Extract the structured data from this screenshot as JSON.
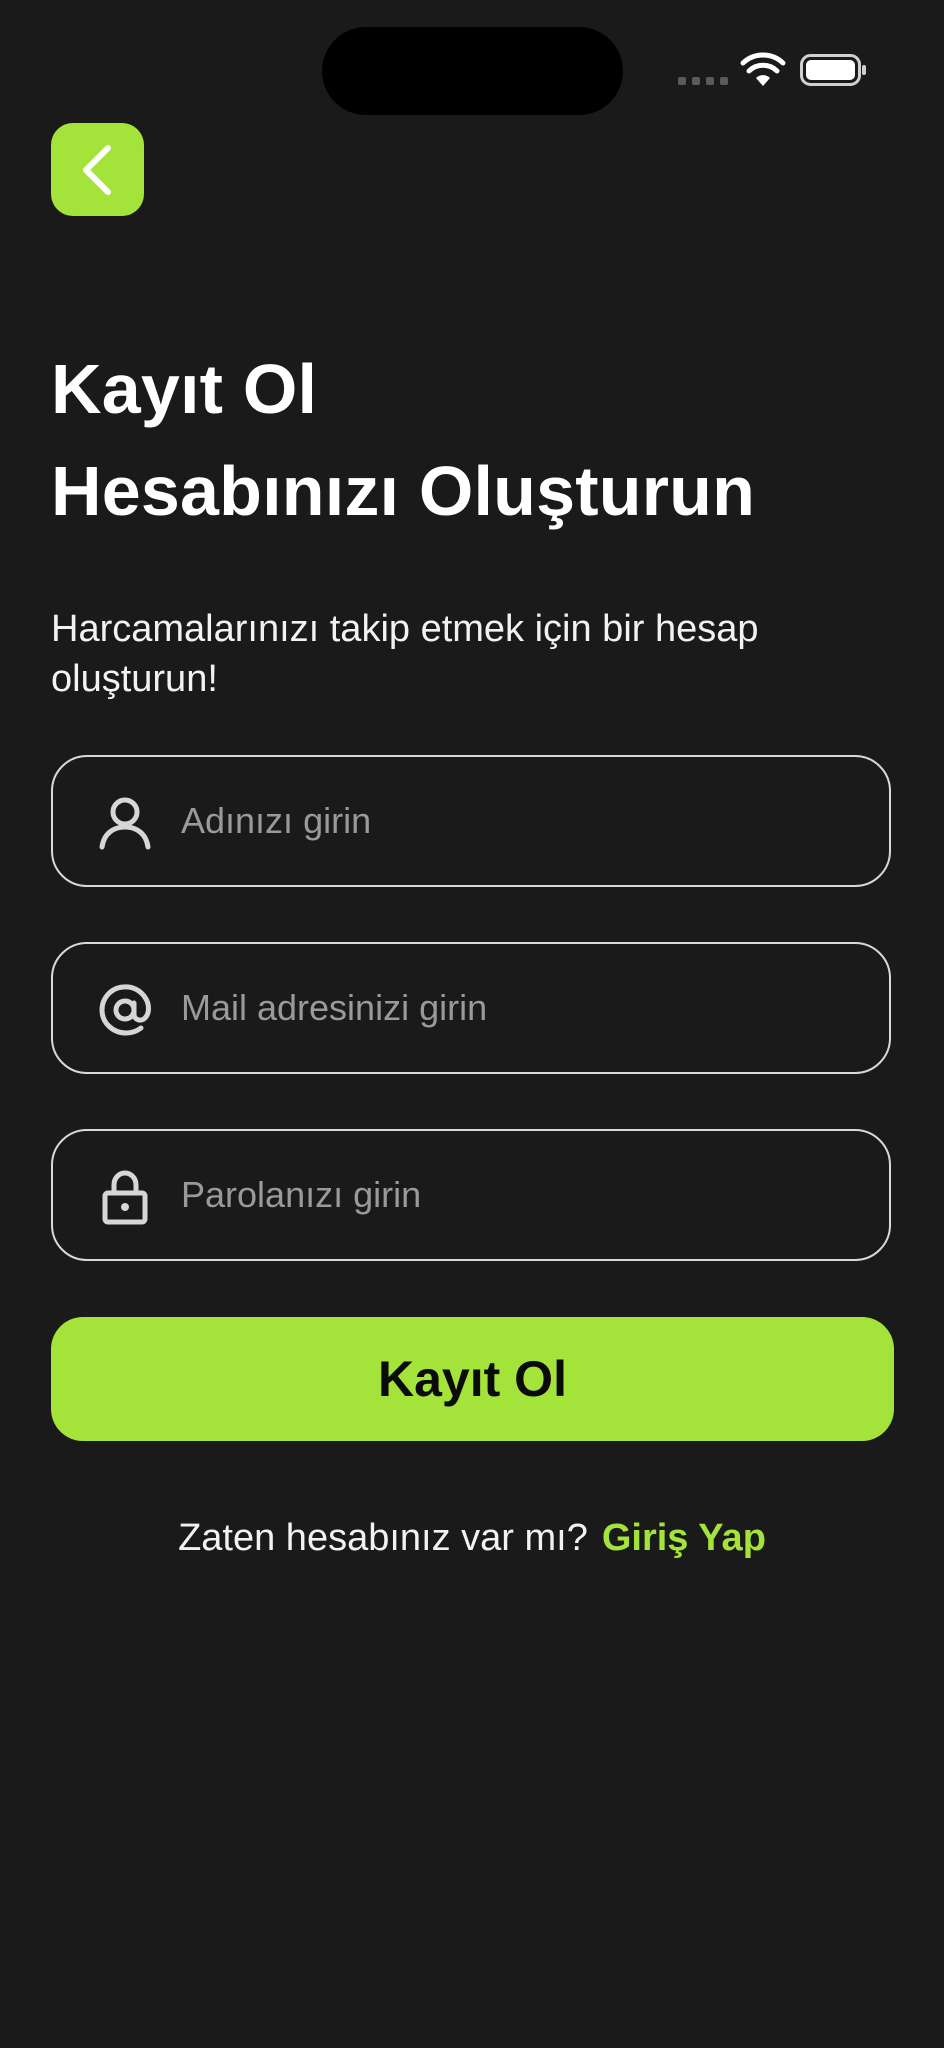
{
  "status_bar": {
    "icons": [
      "signal-icon",
      "wifi-icon",
      "battery-icon"
    ]
  },
  "back_button": {
    "icon": "chevron-left-icon",
    "color": "#a4e33a"
  },
  "header": {
    "title_line1": "Kayıt Ol",
    "title_line2": "Hesabınızı Oluşturun",
    "subtitle": "Harcamalarınızı takip etmek için bir hesap oluşturun!"
  },
  "form": {
    "name_field": {
      "icon": "user-icon",
      "placeholder": "Adınızı girin",
      "value": ""
    },
    "email_field": {
      "icon": "at-sign-icon",
      "placeholder": "Mail adresinizi girin",
      "value": ""
    },
    "password_field": {
      "icon": "lock-icon",
      "placeholder": "Parolanızı girin",
      "value": ""
    },
    "submit_label": "Kayıt Ol"
  },
  "footer": {
    "question": "Zaten hesabınız var mı?",
    "login_link": "Giriş Yap"
  },
  "colors": {
    "background": "#1a1a1a",
    "accent": "#a4e33a",
    "text": "#ffffff",
    "placeholder": "#9a9a9a"
  }
}
